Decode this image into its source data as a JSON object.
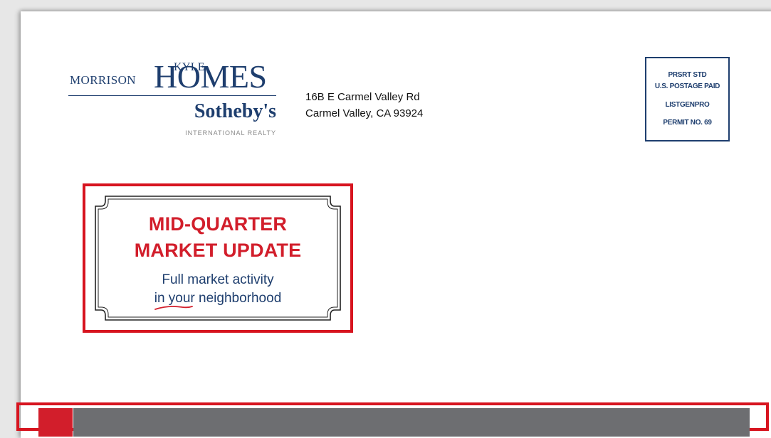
{
  "logo": {
    "line_kyle": "KYLE",
    "line_morrison": "MORRISON",
    "line_homes": "HOMES",
    "brand": "Sotheby's",
    "brand_sub": "INTERNATIONAL REALTY"
  },
  "return_address": {
    "street": "16B E Carmel Valley Rd",
    "city_line": "Carmel Valley, CA 93924"
  },
  "postage_indicia": {
    "line1": "PRSRT STD",
    "line2": "U.S. POSTAGE PAID",
    "line3": "LISTGENPRO",
    "line4": "PERMIT NO. 69"
  },
  "callout": {
    "headline_1": "MID-QUARTER",
    "headline_2": "MARKET UPDATE",
    "subline_1": "Full market activity",
    "subline_2": "in your neighborhood"
  },
  "colors": {
    "brand_navy": "#1e3e6e",
    "accent_red": "#d21e2b",
    "highlight_red": "#d7141f",
    "bar_gray": "#6d6e71"
  }
}
